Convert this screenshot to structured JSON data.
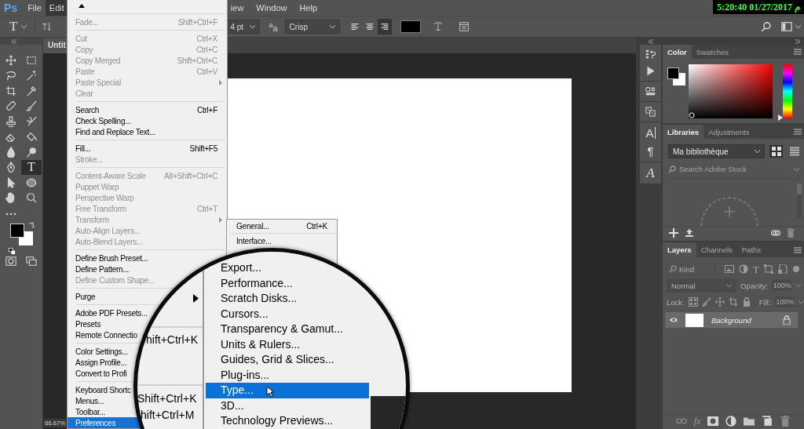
{
  "menu_bar": {
    "logo": "Ps",
    "items": [
      {
        "label": "File",
        "selected": false
      },
      {
        "label": "Edit",
        "selected": true
      }
    ],
    "items_right": [
      {
        "label": "iew",
        "selected": false
      },
      {
        "label": "Window",
        "selected": false
      },
      {
        "label": "Help",
        "selected": false
      }
    ],
    "clock": "5:20:40 01/27/2017 م"
  },
  "options_bar": {
    "tool_glyph": "T",
    "font_size": "4 pt",
    "anti_alias_glyph": "$^{a}$a",
    "anti_alias": "Crisp",
    "align": [
      {
        "selected": false
      },
      {
        "selected": false
      },
      {
        "selected": true
      }
    ]
  },
  "tools": [
    {
      "selected": false
    },
    {
      "selected": false
    },
    {
      "selected": false
    },
    {
      "selected": false
    },
    {
      "selected": false
    },
    {
      "selected": false
    },
    {
      "selected": false
    },
    {
      "selected": false
    },
    {
      "selected": false
    },
    {
      "selected": false
    },
    {
      "selected": false
    },
    {
      "selected": false
    },
    {
      "selected": false
    },
    {
      "selected": false
    },
    {
      "selected": false
    },
    {
      "selected": true,
      "glyph": "T"
    },
    {
      "selected": false
    },
    {
      "selected": false
    },
    {
      "selected": false
    },
    {
      "selected": false
    }
  ],
  "document_tab": {
    "title": "Untit"
  },
  "status_bar": {
    "zoom": "66.67%"
  },
  "dock_glyphs": [
    "A",
    "¶",
    "A"
  ],
  "color_panel": {
    "tabs": [
      {
        "label": "Color",
        "selected": true
      },
      {
        "label": "Swatches",
        "selected": false
      }
    ],
    "hue_slider": {
      "level": 0
    }
  },
  "libraries_panel": {
    "tabs": [
      {
        "label": "Libraries",
        "selected": true
      },
      {
        "label": "Adjustments",
        "selected": false
      }
    ],
    "library": "Ma bibliothèque",
    "views": [
      {
        "selected": true
      },
      {
        "selected": false
      }
    ],
    "search": {
      "placeholder": "Search Adobe Stock"
    }
  },
  "layers_panel": {
    "tabs": [
      {
        "label": "Layers",
        "selected": true
      },
      {
        "label": "Channels",
        "selected": false
      },
      {
        "label": "Paths",
        "selected": false
      }
    ],
    "filter": {
      "placeholder": "Kind",
      "type_glyph": "T"
    },
    "controls_disabled": true,
    "blend_mode": "Normal",
    "opacity_label": "Opacity:",
    "opacity": "100%",
    "lock_label": "Lock:",
    "fill_label": "Fill:",
    "fill": "100%",
    "layers": [
      {
        "name": "Background",
        "visible": true,
        "locked": true,
        "selected": true
      }
    ],
    "effects_label": "fx"
  },
  "edit_menu": {
    "items": [
      {
        "kind": "separator"
      },
      {
        "kind": "item",
        "label": "Fade...",
        "shortcut": "Shift+Ctrl+F",
        "disabled": true,
        "selected": false,
        "submenu": false
      },
      {
        "kind": "separator"
      },
      {
        "kind": "item",
        "label": "Cut",
        "shortcut": "Ctrl+X",
        "disabled": true,
        "selected": false,
        "submenu": false
      },
      {
        "kind": "item",
        "label": "Copy",
        "shortcut": "Ctrl+C",
        "disabled": true,
        "selected": false,
        "submenu": false
      },
      {
        "kind": "item",
        "label": "Copy Merged",
        "shortcut": "Shift+Ctrl+C",
        "disabled": true,
        "selected": false,
        "submenu": false
      },
      {
        "kind": "item",
        "label": "Paste",
        "shortcut": "Ctrl+V",
        "disabled": true,
        "selected": false,
        "submenu": false
      },
      {
        "kind": "item",
        "label": "Paste Special",
        "disabled": true,
        "selected": false,
        "submenu": true
      },
      {
        "kind": "item",
        "label": "Clear",
        "disabled": true,
        "selected": false,
        "submenu": false
      },
      {
        "kind": "separator"
      },
      {
        "kind": "item",
        "label": "Search",
        "shortcut": "Ctrl+F",
        "disabled": false,
        "selected": false,
        "submenu": false
      },
      {
        "kind": "item",
        "label": "Check Spelling...",
        "disabled": false,
        "selected": false,
        "submenu": false
      },
      {
        "kind": "item",
        "label": "Find and Replace Text...",
        "disabled": false,
        "selected": false,
        "submenu": false
      },
      {
        "kind": "separator"
      },
      {
        "kind": "item",
        "label": "Fill...",
        "shortcut": "Shift+F5",
        "disabled": false,
        "selected": false,
        "submenu": false
      },
      {
        "kind": "item",
        "label": "Stroke...",
        "disabled": true,
        "selected": false,
        "submenu": false
      },
      {
        "kind": "separator"
      },
      {
        "kind": "item",
        "label": "Content-Aware Scale",
        "shortcut": "Alt+Shift+Ctrl+C",
        "disabled": true,
        "selected": false,
        "submenu": false
      },
      {
        "kind": "item",
        "label": "Puppet Warp",
        "disabled": true,
        "selected": false,
        "submenu": false
      },
      {
        "kind": "item",
        "label": "Perspective Warp",
        "disabled": true,
        "selected": false,
        "submenu": false
      },
      {
        "kind": "item",
        "label": "Free Transform",
        "shortcut": "Ctrl+T",
        "disabled": true,
        "selected": false,
        "submenu": false
      },
      {
        "kind": "item",
        "label": "Transform",
        "disabled": true,
        "selected": false,
        "submenu": true
      },
      {
        "kind": "item",
        "label": "Auto-Align Layers...",
        "disabled": true,
        "selected": false,
        "submenu": false
      },
      {
        "kind": "item",
        "label": "Auto-Blend Layers...",
        "disabled": true,
        "selected": false,
        "submenu": false
      },
      {
        "kind": "separator"
      },
      {
        "kind": "item",
        "label": "Define Brush Preset...",
        "disabled": false,
        "selected": false,
        "submenu": false
      },
      {
        "kind": "item",
        "label": "Define Pattern...",
        "disabled": false,
        "selected": false,
        "submenu": false
      },
      {
        "kind": "item",
        "label": "Define Custom Shape...",
        "disabled": true,
        "selected": false,
        "submenu": false
      },
      {
        "kind": "separator"
      },
      {
        "kind": "item",
        "label": "Purge",
        "disabled": false,
        "selected": false,
        "submenu": false
      },
      {
        "kind": "separator"
      },
      {
        "kind": "item",
        "label": "Adobe PDF Presets...",
        "disabled": false,
        "selected": false,
        "submenu": false
      },
      {
        "kind": "item",
        "label": "Presets",
        "disabled": false,
        "selected": false,
        "submenu": false
      },
      {
        "kind": "item",
        "label": "Remote Connectio",
        "disabled": false,
        "selected": false,
        "submenu": false
      },
      {
        "kind": "separator"
      },
      {
        "kind": "item",
        "label": "Color Settings...",
        "disabled": false,
        "selected": false,
        "submenu": false
      },
      {
        "kind": "item",
        "label": "Assign Profile...",
        "disabled": false,
        "selected": false,
        "submenu": false
      },
      {
        "kind": "item",
        "label": "Convert to Profi",
        "disabled": false,
        "selected": false,
        "submenu": false
      },
      {
        "kind": "separator"
      },
      {
        "kind": "item",
        "label": "Keyboard Shortc",
        "disabled": false,
        "selected": false,
        "submenu": false
      },
      {
        "kind": "item",
        "label": "Menus...",
        "disabled": false,
        "selected": false,
        "submenu": false
      },
      {
        "kind": "item",
        "label": "Toolbar...",
        "disabled": false,
        "selected": false,
        "submenu": false
      },
      {
        "kind": "item",
        "label": "Preferences",
        "disabled": false,
        "selected": true,
        "submenu": false
      }
    ]
  },
  "preferences_submenu": {
    "items": [
      {
        "label": "General...",
        "shortcut": "Ctrl+K"
      },
      {
        "label": "Interface..."
      }
    ]
  },
  "magnifier": {
    "menu_fragments": [
      "hift+Ctrl+K",
      "Shift+Ctrl+K",
      "hift+Ctrl+M"
    ],
    "items": [
      {
        "label": "Export...",
        "selected": false
      },
      {
        "label": "Performance...",
        "selected": false
      },
      {
        "label": "Scratch Disks...",
        "selected": false
      },
      {
        "label": "Cursors...",
        "selected": false
      },
      {
        "label": "Transparency & Gamut...",
        "selected": false
      },
      {
        "label": "Units & Rulers...",
        "selected": false
      },
      {
        "label": "Guides, Grid & Slices...",
        "selected": false
      },
      {
        "label": "Plug-ins...",
        "selected": false
      },
      {
        "label": "Type...",
        "selected": true
      },
      {
        "label": "3D...",
        "selected": false
      },
      {
        "label": "Technology Previews...",
        "selected": false
      }
    ]
  }
}
